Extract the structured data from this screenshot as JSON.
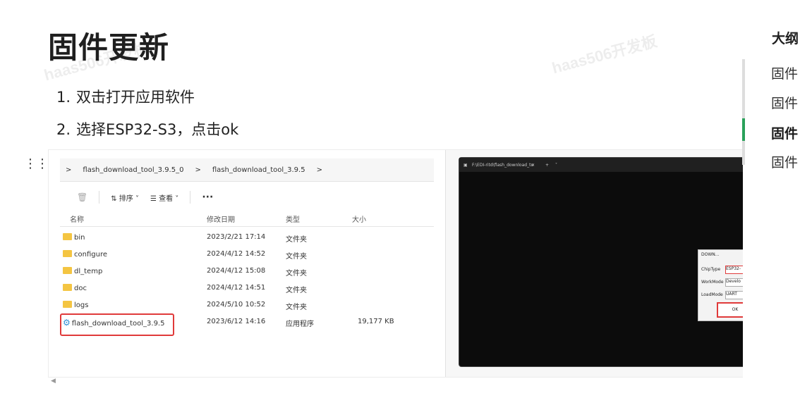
{
  "page": {
    "title": "固件更新",
    "watermark": "haas506开发板",
    "steps": [
      {
        "num": "1.",
        "text": "双击打开应用软件"
      },
      {
        "num": "2.",
        "text": "选择ESP32-S3，点击ok"
      }
    ]
  },
  "explorer": {
    "breadcrumb": [
      ">",
      "flash_download_tool_3.9.5_0",
      ">",
      "flash_download_tool_3.9.5",
      ">"
    ],
    "toolbar": {
      "sort": "⇅ 排序 ˅",
      "view": "☰ 查看 ˅",
      "more": "···"
    },
    "columns": [
      "名称",
      "修改日期",
      "类型",
      "大小"
    ],
    "rows": [
      {
        "name": "bin",
        "date": "2023/2/21 17:14",
        "type": "文件夹",
        "size": ""
      },
      {
        "name": "configure",
        "date": "2024/4/12 14:52",
        "type": "文件夹",
        "size": ""
      },
      {
        "name": "dl_temp",
        "date": "2024/4/12 15:08",
        "type": "文件夹",
        "size": ""
      },
      {
        "name": "doc",
        "date": "2024/4/12 14:51",
        "type": "文件夹",
        "size": ""
      },
      {
        "name": "logs",
        "date": "2024/5/10 10:52",
        "type": "文件夹",
        "size": ""
      },
      {
        "name": "flash_download_tool_3.9.5",
        "date": "2023/6/12 14:16",
        "type": "应用程序",
        "size": "19,177 KB"
      }
    ]
  },
  "terminal": {
    "tab": "F:\\EDI-ritd\\flash_download_to",
    "dialog": {
      "title": "DOWN...",
      "chip_label": "ChipType",
      "chip_value": "ESP32-",
      "work_label": "WorkMode",
      "work_value": "Develo",
      "load_label": "LoadMode",
      "load_value": "UART",
      "ok": "OK"
    }
  },
  "outline": {
    "title": "大纲",
    "items": [
      "固件",
      "固件",
      "固件",
      "固件"
    ],
    "active_index": 2
  }
}
